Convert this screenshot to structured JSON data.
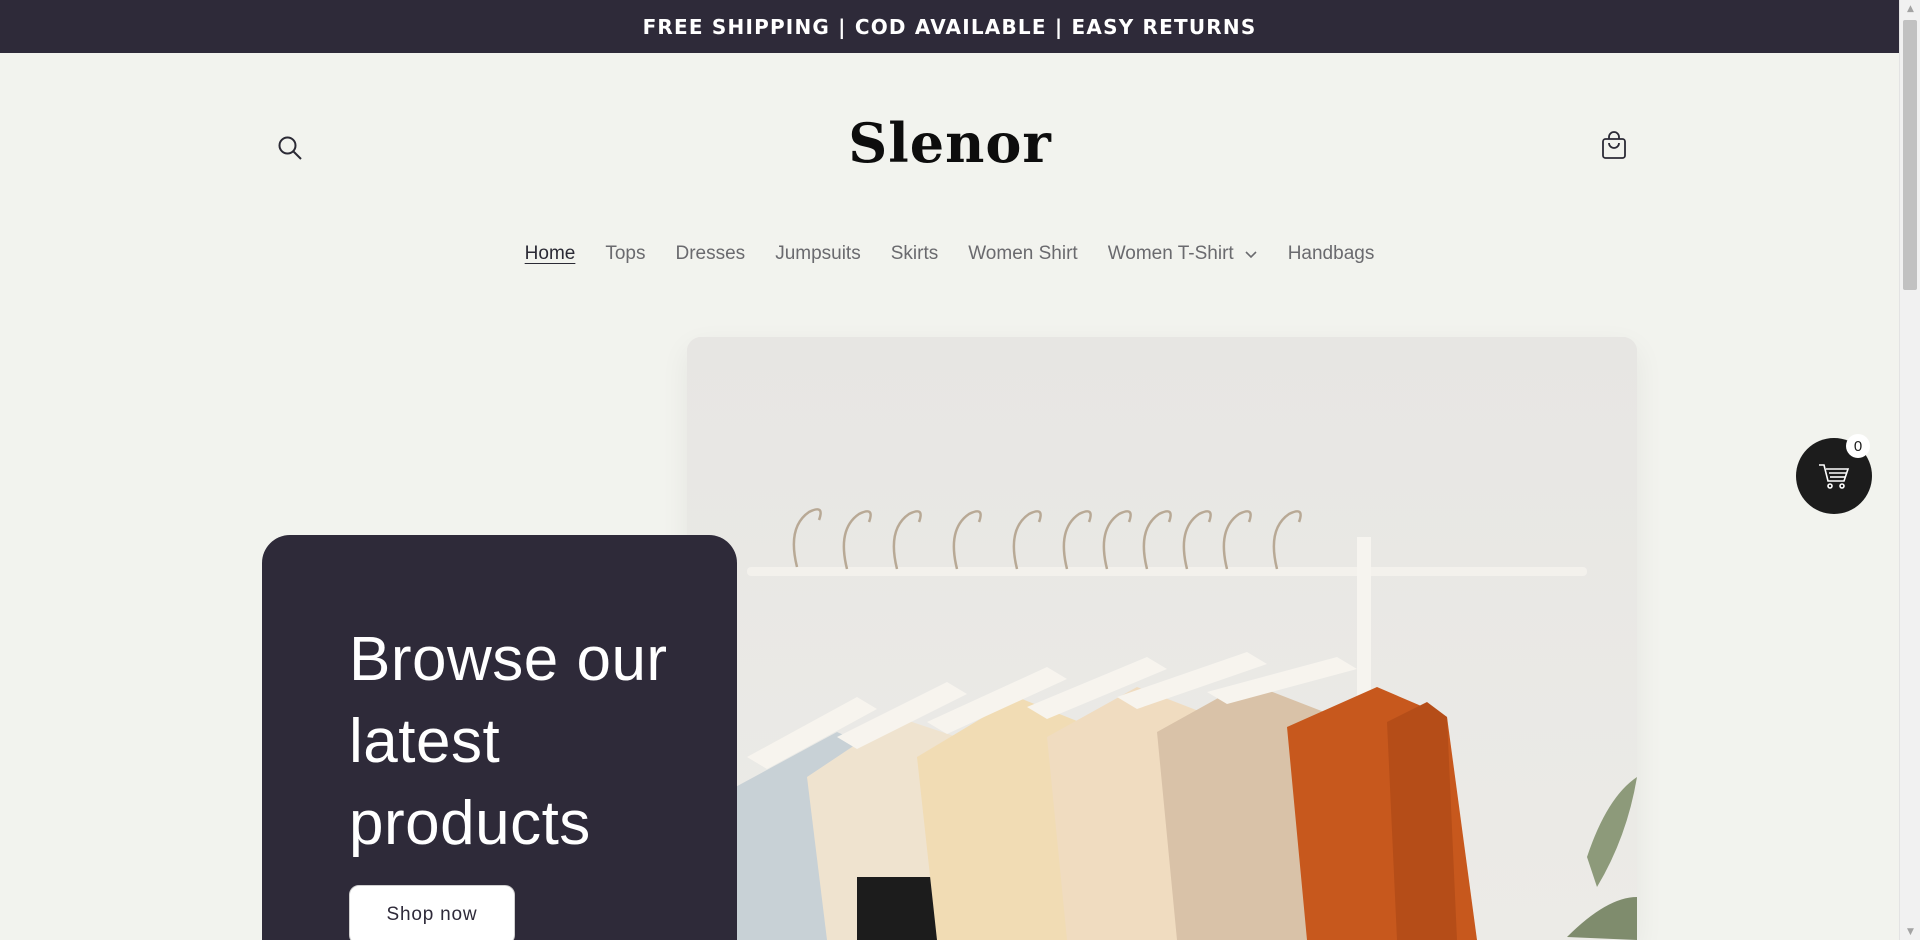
{
  "announcement": {
    "text": "FREE SHIPPING | COD AVAILABLE | EASY RETURNS"
  },
  "header": {
    "logo_text": "Slenor",
    "search_icon": "search-icon",
    "cart_icon": "bag-icon"
  },
  "nav": {
    "items": [
      {
        "label": "Home",
        "active": true
      },
      {
        "label": "Tops"
      },
      {
        "label": "Dresses"
      },
      {
        "label": "Jumpsuits"
      },
      {
        "label": "Skirts"
      },
      {
        "label": "Women Shirt"
      },
      {
        "label": "Women T-Shirt",
        "has_dropdown": true
      },
      {
        "label": "Handbags"
      }
    ]
  },
  "hero": {
    "heading": "Browse our latest products",
    "button_label": "Shop now",
    "image_icon": "clothes-rack-image"
  },
  "floating_cart": {
    "count": "0",
    "icon": "shopping-cart-icon"
  },
  "colors": {
    "background": "#f2f3ee",
    "dark": "#2e2a39",
    "text": "#2b2a35"
  }
}
